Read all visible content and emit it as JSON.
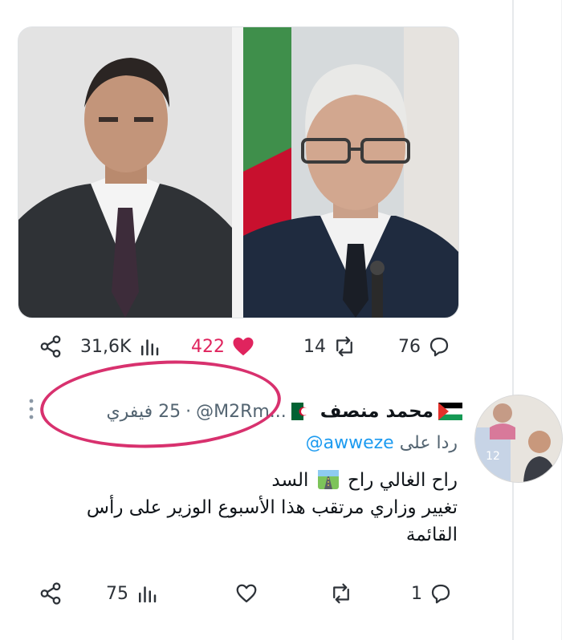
{
  "media": {
    "left_photo_alt": "portrait-left",
    "right_photo_alt": "portrait-right"
  },
  "main_tweet_actions": {
    "views": "31,6K",
    "likes": "422",
    "retweets": "14",
    "replies": "76",
    "like_color": "#e0245e"
  },
  "reply_tweet": {
    "name": "محمد منصف",
    "handle": "@M2Rm...",
    "dot": "·",
    "date": "25 فيفري",
    "reply_prefix": "ردا على",
    "reply_mention": "@awweze",
    "line1_before": "راح الغالي راح",
    "line1_after": "السد",
    "line2": "تغيير وزاري مرتقب هذا الأسبوع  الوزير على رأس القائمة",
    "actions": {
      "views": "75",
      "likes": "",
      "retweets": "",
      "replies": "1"
    }
  },
  "colors": {
    "accent_link": "#1d9bf0",
    "annotation_circle": "#d8316e",
    "secondary_text": "#536471"
  }
}
